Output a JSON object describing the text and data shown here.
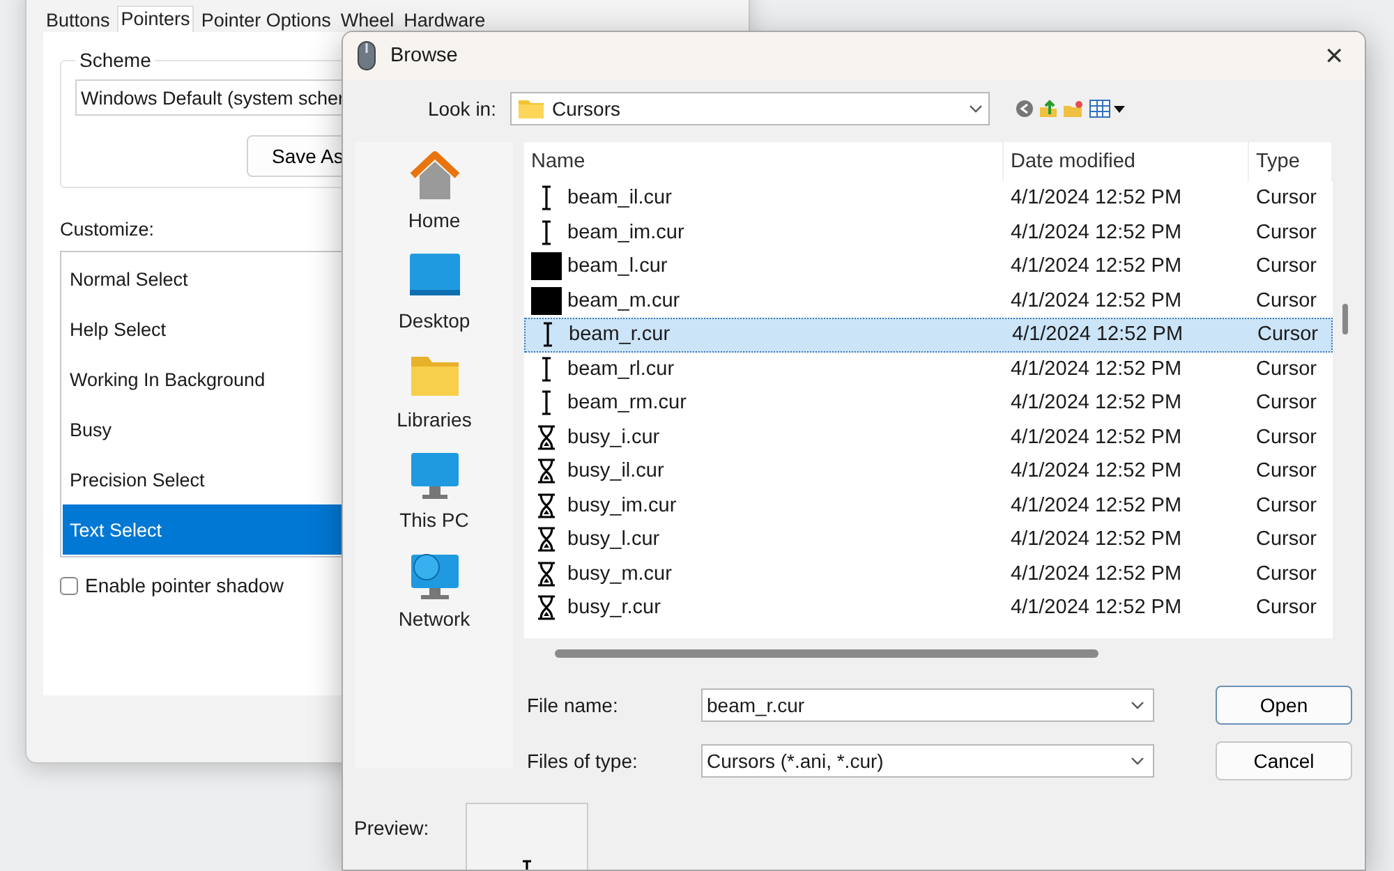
{
  "settings_window": {
    "tabs": [
      {
        "label": "Buttons",
        "selected": false
      },
      {
        "label": "Pointers",
        "selected": true
      },
      {
        "label": "Pointer Options",
        "selected": false
      },
      {
        "label": "Wheel",
        "selected": false
      },
      {
        "label": "Hardware",
        "selected": false
      }
    ],
    "scheme": {
      "title": "Scheme",
      "value": "Windows Default (system scher",
      "save_button": "Save As"
    },
    "customize_label": "Customize:",
    "cursor_roles": [
      {
        "label": "Normal Select",
        "selected": false
      },
      {
        "label": "Help Select",
        "selected": false
      },
      {
        "label": "Working In Background",
        "selected": false
      },
      {
        "label": "Busy",
        "selected": false
      },
      {
        "label": "Precision Select",
        "selected": false
      },
      {
        "label": "Text Select",
        "selected": true
      }
    ],
    "shadow_checkbox": {
      "label": "Enable pointer shadow",
      "checked": false
    }
  },
  "browse_dialog": {
    "title": "Browse",
    "close": "✕",
    "look_in": {
      "label": "Look in:",
      "value": "Cursors"
    },
    "places": [
      {
        "label": "Home",
        "kind": "home"
      },
      {
        "label": "Desktop",
        "kind": "desktop"
      },
      {
        "label": "Libraries",
        "kind": "folder"
      },
      {
        "label": "This PC",
        "kind": "pc"
      },
      {
        "label": "Network",
        "kind": "network"
      }
    ],
    "columns": [
      "Name",
      "Date modified",
      "Type"
    ],
    "files": [
      {
        "name": "beam_il.cur",
        "modified": "4/1/2024 12:52 PM",
        "type": "Cursor",
        "kind": "ibeam",
        "selected": false
      },
      {
        "name": "beam_im.cur",
        "modified": "4/1/2024 12:52 PM",
        "type": "Cursor",
        "kind": "ibeam",
        "selected": false
      },
      {
        "name": "beam_l.cur",
        "modified": "4/1/2024 12:52 PM",
        "type": "Cursor",
        "kind": "block",
        "selected": false
      },
      {
        "name": "beam_m.cur",
        "modified": "4/1/2024 12:52 PM",
        "type": "Cursor",
        "kind": "block",
        "selected": false
      },
      {
        "name": "beam_r.cur",
        "modified": "4/1/2024 12:52 PM",
        "type": "Cursor",
        "kind": "ibeam",
        "selected": true
      },
      {
        "name": "beam_rl.cur",
        "modified": "4/1/2024 12:52 PM",
        "type": "Cursor",
        "kind": "ibeam",
        "selected": false
      },
      {
        "name": "beam_rm.cur",
        "modified": "4/1/2024 12:52 PM",
        "type": "Cursor",
        "kind": "ibeam",
        "selected": false
      },
      {
        "name": "busy_i.cur",
        "modified": "4/1/2024 12:52 PM",
        "type": "Cursor",
        "kind": "hourglass",
        "selected": false
      },
      {
        "name": "busy_il.cur",
        "modified": "4/1/2024 12:52 PM",
        "type": "Cursor",
        "kind": "hourglass",
        "selected": false
      },
      {
        "name": "busy_im.cur",
        "modified": "4/1/2024 12:52 PM",
        "type": "Cursor",
        "kind": "hourglass",
        "selected": false
      },
      {
        "name": "busy_l.cur",
        "modified": "4/1/2024 12:52 PM",
        "type": "Cursor",
        "kind": "hourglass",
        "selected": false
      },
      {
        "name": "busy_m.cur",
        "modified": "4/1/2024 12:52 PM",
        "type": "Cursor",
        "kind": "hourglass",
        "selected": false
      },
      {
        "name": "busy_r.cur",
        "modified": "4/1/2024 12:52 PM",
        "type": "Cursor",
        "kind": "hourglass",
        "selected": false
      }
    ],
    "file_name": {
      "label": "File name:",
      "value": "beam_r.cur"
    },
    "file_type": {
      "label": "Files of type:",
      "value": "Cursors (*.ani, *.cur)"
    },
    "buttons": [
      "Open",
      "Cancel"
    ],
    "preview_label": "Preview:"
  }
}
